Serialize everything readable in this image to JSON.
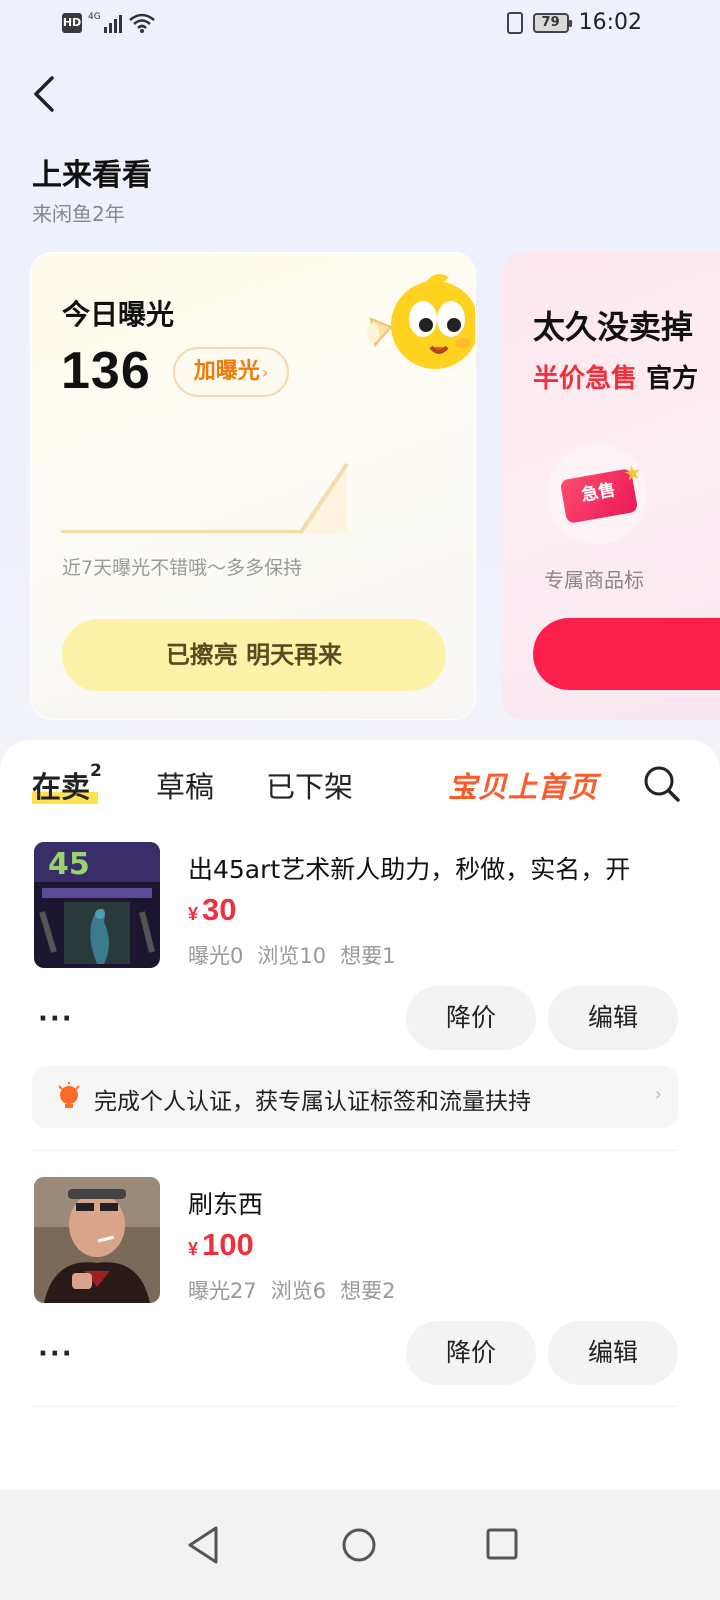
{
  "status_bar": {
    "hd": "HD",
    "network": "4G",
    "battery": "79",
    "time": "16:02"
  },
  "header": {
    "title": "上来看看",
    "subtitle": "来闲鱼2年"
  },
  "exposure_card": {
    "label": "今日曝光",
    "value": "136",
    "boost_label": "加曝光",
    "note": "近7天曝光不错哦～多多保持",
    "polish_button": "已擦亮 明天再来"
  },
  "sale_card": {
    "title": "太久没卖掉",
    "subtitle_red": "半价急售",
    "subtitle_rest": "官方",
    "badge_text": "急售",
    "feature": "专属商品标"
  },
  "tabs": {
    "on_sale": "在卖",
    "on_sale_count": "2",
    "drafts": "草稿",
    "removed": "已下架",
    "promo": "宝贝上首页"
  },
  "items": [
    {
      "title": "出45art艺术新人助力，秒做，实名，开",
      "currency": "¥",
      "price": "30",
      "stats": [
        "曝光0",
        "浏览10",
        "想要1"
      ],
      "more": "···",
      "reduce_price": "降价",
      "edit": "编辑"
    },
    {
      "title": "刷东西",
      "currency": "¥",
      "price": "100",
      "stats": [
        "曝光27",
        "浏览6",
        "想要2"
      ],
      "more": "···",
      "reduce_price": "降价",
      "edit": "编辑"
    }
  ],
  "verify_banner": {
    "text": "完成个人认证，获专属认证标签和流量扶持"
  },
  "colors": {
    "accent_red": "#f0303c",
    "highlight_yellow": "#ffe34d",
    "promo_orange": "#ff5a2a",
    "polish_yellow": "#fdf2a8",
    "cta_red": "#fb1f4c"
  },
  "icons": {
    "back": "chevron-left-icon",
    "search": "search-icon",
    "nav_back": "triangle-back-icon",
    "nav_home": "circle-home-icon",
    "nav_recent": "square-recent-icon"
  }
}
